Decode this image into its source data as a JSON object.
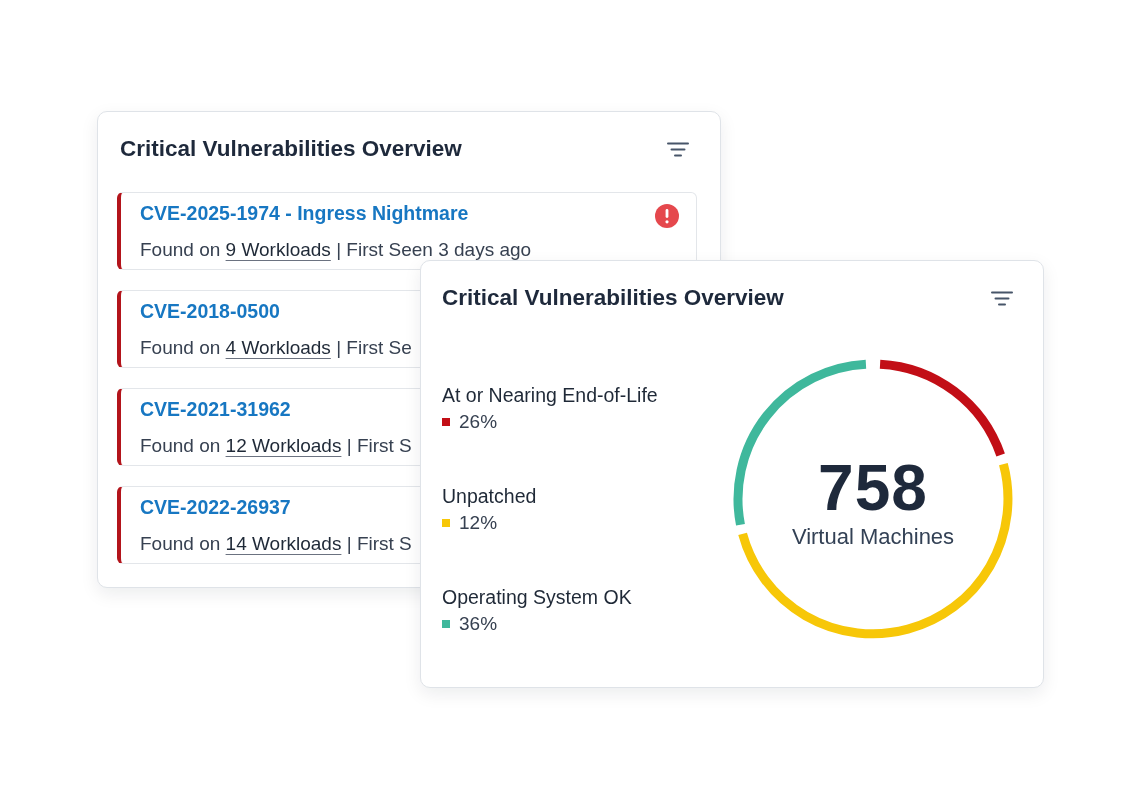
{
  "back_panel": {
    "title": "Critical Vulnerabilities Overview",
    "vulnerabilities": [
      {
        "name": "CVE-2025-1974 - Ingress Nightmare",
        "found_on": "Found on",
        "workloads": "9 Workloads",
        "separator": "|",
        "first_seen": "First Seen 3 days ago",
        "alert": true
      },
      {
        "name": "CVE-2018-0500",
        "found_on": "Found on",
        "workloads": "4 Workloads",
        "separator": "|",
        "first_seen": "First Se",
        "alert": false
      },
      {
        "name": "CVE-2021-31962",
        "found_on": "Found on",
        "workloads": "12 Workloads",
        "separator": "|",
        "first_seen": "First S",
        "alert": false
      },
      {
        "name": "CVE-2022-26937",
        "found_on": "Found on",
        "workloads": "14 Workloads",
        "separator": "|",
        "first_seen": "First S",
        "alert": false
      }
    ]
  },
  "front_panel": {
    "title": "Critical Vulnerabilities Overview",
    "legend": [
      {
        "label": "At or Nearing End-of-Life",
        "value": "26%",
        "color": "#c20e16"
      },
      {
        "label": "Unpatched",
        "value": "12%",
        "color": "#f7c708"
      },
      {
        "label": "Operating System OK",
        "value": "36%",
        "color": "#3fb89c"
      }
    ],
    "total": "758",
    "total_label": "Virtual Machines"
  }
}
